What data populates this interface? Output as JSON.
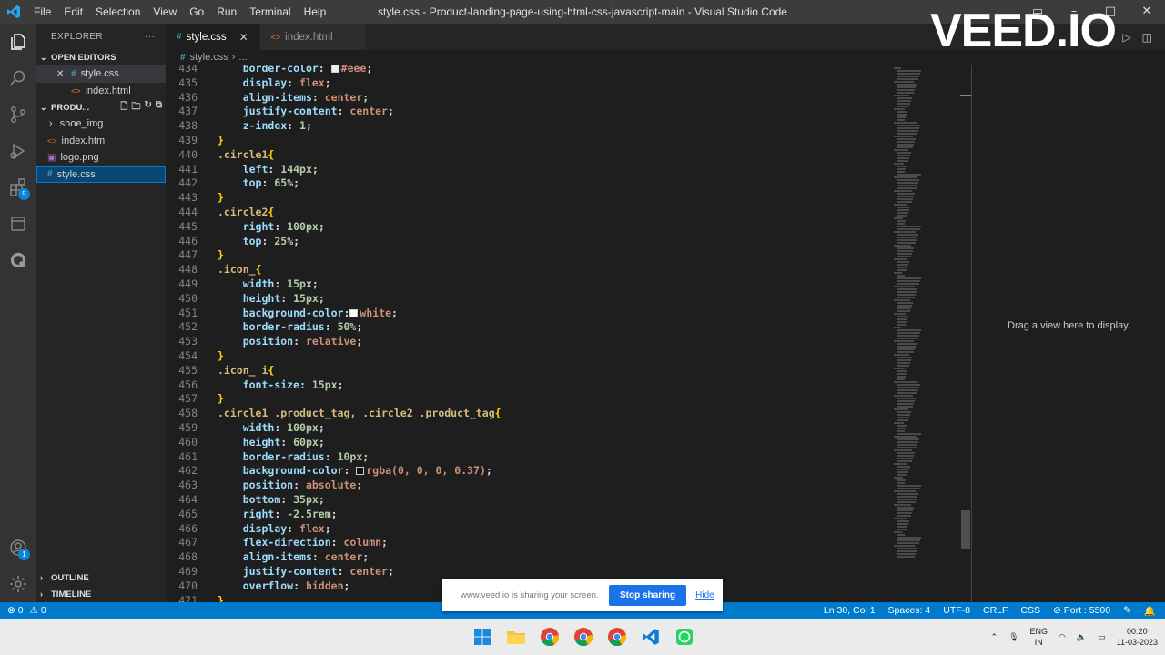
{
  "window": {
    "title": "style.css - Product-landing-page-using-html-css-javascript-main - Visual Studio Code",
    "menu": [
      "File",
      "Edit",
      "Selection",
      "View",
      "Go",
      "Run",
      "Terminal",
      "Help"
    ]
  },
  "sidebar": {
    "title": "EXPLORER",
    "open_editors_label": "OPEN EDITORS",
    "open_editors": [
      {
        "name": "style.css",
        "type": "css",
        "active": true
      },
      {
        "name": "index.html",
        "type": "html",
        "active": false
      }
    ],
    "project_label": "PRODU...",
    "files": [
      {
        "name": "shoe_img",
        "type": "folder"
      },
      {
        "name": "index.html",
        "type": "html"
      },
      {
        "name": "logo.png",
        "type": "png"
      },
      {
        "name": "style.css",
        "type": "css",
        "selected": true
      }
    ],
    "outline_label": "OUTLINE",
    "timeline_label": "TIMELINE",
    "extensions_badge": "5",
    "account_badge": "1"
  },
  "tabs": [
    {
      "label": "style.css",
      "icon": "css",
      "active": true
    },
    {
      "label": "index.html",
      "icon": "html",
      "active": false
    }
  ],
  "breadcrumb": {
    "file": "style.css",
    "rest": "..."
  },
  "editor": {
    "lines": [
      {
        "n": "434",
        "t": "    border-color: ■#eee;"
      },
      {
        "n": "435",
        "t": "    display: flex;"
      },
      {
        "n": "436",
        "t": "    align-items: center;"
      },
      {
        "n": "437",
        "t": "    justify-content: center;"
      },
      {
        "n": "438",
        "t": "    z-index: 1;"
      },
      {
        "n": "439",
        "t": "}"
      },
      {
        "n": "440",
        "t": ".circle1{"
      },
      {
        "n": "441",
        "t": "    left: 144px;"
      },
      {
        "n": "442",
        "t": "    top: 65%;"
      },
      {
        "n": "443",
        "t": "}"
      },
      {
        "n": "444",
        "t": ".circle2{"
      },
      {
        "n": "445",
        "t": "    right: 100px;"
      },
      {
        "n": "446",
        "t": "    top: 25%;"
      },
      {
        "n": "447",
        "t": "}"
      },
      {
        "n": "448",
        "t": ".icon_{"
      },
      {
        "n": "449",
        "t": "    width: 15px;"
      },
      {
        "n": "450",
        "t": "    height: 15px;"
      },
      {
        "n": "451",
        "t": "    background-color:□white;"
      },
      {
        "n": "452",
        "t": "    border-radius: 50%;"
      },
      {
        "n": "453",
        "t": "    position: relative;"
      },
      {
        "n": "454",
        "t": "}"
      },
      {
        "n": "455",
        "t": ".icon_ i{"
      },
      {
        "n": "456",
        "t": "    font-size: 15px;"
      },
      {
        "n": "457",
        "t": "}"
      },
      {
        "n": "458",
        "t": ".circle1 .product_tag, .circle2 .product_tag{"
      },
      {
        "n": "459",
        "t": "    width: 100px;"
      },
      {
        "n": "460",
        "t": "    height: 60px;"
      },
      {
        "n": "461",
        "t": "    border-radius: 10px;"
      },
      {
        "n": "462",
        "t": "    background-color: □rgba(0, 0, 0, 0.37);"
      },
      {
        "n": "463",
        "t": "    position: absolute;"
      },
      {
        "n": "464",
        "t": "    bottom: 35px;"
      },
      {
        "n": "465",
        "t": "    right: -2.5rem;"
      },
      {
        "n": "466",
        "t": "    display: flex;"
      },
      {
        "n": "467",
        "t": "    flex-direction: column;"
      },
      {
        "n": "468",
        "t": "    align-items: center;"
      },
      {
        "n": "469",
        "t": "    justify-content: center;"
      },
      {
        "n": "470",
        "t": "    overflow: hidden;"
      },
      {
        "n": "471",
        "t": "}"
      }
    ]
  },
  "right_group": {
    "message": "Drag a view here to display."
  },
  "watermark": "VEED.IO",
  "statusbar": {
    "errors": "0",
    "warnings": "0",
    "position": "Ln 30, Col 1",
    "spaces": "Spaces: 4",
    "encoding": "UTF-8",
    "eol": "CRLF",
    "language": "CSS",
    "port": "Port : 5500"
  },
  "share_banner": {
    "text": "www.veed.io is sharing your screen.",
    "stop_label": "Stop sharing",
    "hide_label": "Hide"
  },
  "taskbar": {
    "lang_line1": "ENG",
    "lang_line2": "IN",
    "time": "00:20",
    "date": "11-03-2023"
  },
  "colors": {
    "accent": "#007acc",
    "selector": "#d7ba7d",
    "property": "#9cdcfe",
    "value": "#ce9178",
    "number": "#b5cea8",
    "brace": "#ffd700"
  }
}
